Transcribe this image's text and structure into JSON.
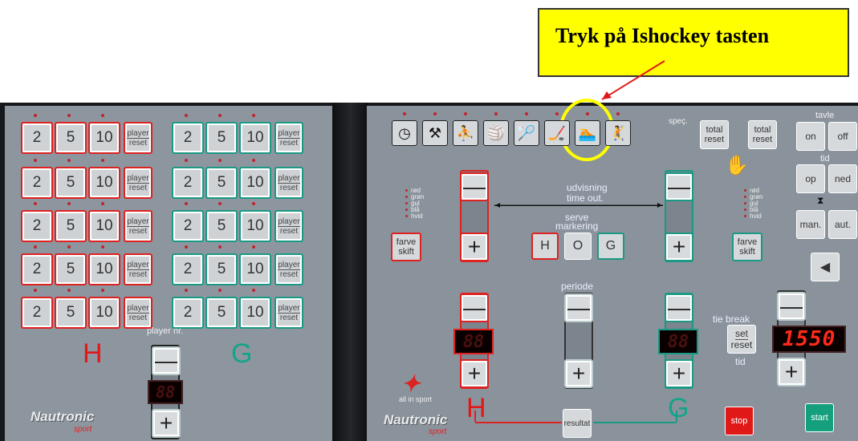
{
  "callout": {
    "text": "Tryk på Ishockey tasten"
  },
  "left_panel": {
    "rows": [
      [
        "2",
        "5",
        "10"
      ],
      [
        "2",
        "5",
        "10"
      ],
      [
        "2",
        "5",
        "10"
      ],
      [
        "2",
        "5",
        "10"
      ],
      [
        "2",
        "5",
        "10"
      ]
    ],
    "player_reset": [
      "player",
      "reset"
    ],
    "player_nr_label": "player nr.",
    "home_letter": "H",
    "guest_letter": "G",
    "minus": "—",
    "plus": "+",
    "brand": "Nautronic",
    "brand_sub": "sport"
  },
  "right_panel": {
    "sport_icons": [
      "clock-icon",
      "hockey-stick-icon",
      "basketball-icon",
      "volleyball-icon",
      "badminton-icon",
      "icehockey-icon",
      "swimming-icon",
      "handball-icon"
    ],
    "spec_label": "speç.",
    "total_reset": [
      "total",
      "reset"
    ],
    "tavle_label": "tavle",
    "tid_label": "tid",
    "on_label": "on",
    "off_label": "off",
    "op_label": "op",
    "ned_label": "ned",
    "man_label": "man.",
    "aut_label": "aut.",
    "udvisning": "udvisning",
    "time_out": "time out.",
    "serve": "serve",
    "markering": "markering",
    "h_btn": "H",
    "o_btn": "O",
    "g_btn": "G",
    "colors": [
      "rød",
      "grøn",
      "gul",
      "blå",
      "hvid"
    ],
    "farve": "farve",
    "skift": "skift",
    "periode": "periode",
    "tie_break": "tie break",
    "set": "set",
    "reset": "reset",
    "tid": "tid",
    "time_display": "1550",
    "home_display": "88",
    "guest_display": "88",
    "player_display": "88",
    "H": "H",
    "G": "G",
    "resultat": "resultat",
    "stop": "stop",
    "start": "start",
    "all_in_sport": "all in sport",
    "brand": "Nautronic",
    "brand_sub": "sport"
  },
  "accent": {
    "callout_bg": "#ffff00",
    "home": "#e01818",
    "guest": "#12a088",
    "highlight": "#ffff00"
  }
}
